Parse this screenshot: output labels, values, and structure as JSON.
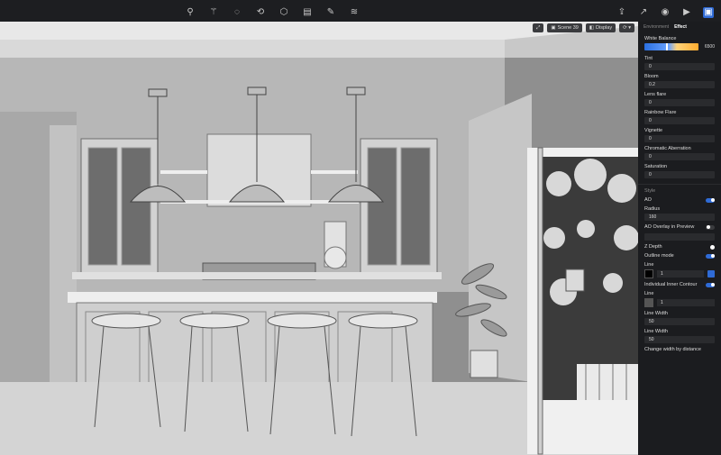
{
  "tools": [
    "pin-icon",
    "wand-icon",
    "lasso-icon",
    "refresh-icon",
    "cube-icon",
    "film-icon",
    "brush-icon",
    "layers-icon"
  ],
  "right_icons": [
    "import-icon",
    "share-icon",
    "camera-icon",
    "video-icon",
    "panel-icon"
  ],
  "viewport": {
    "scene_label": "Scene 39",
    "display_label": "Display"
  },
  "panel": {
    "tabs": [
      {
        "label": "Environment"
      },
      {
        "label": "Effect"
      }
    ],
    "white_balance": {
      "label": "White Balance",
      "value": "6500"
    },
    "effects": [
      {
        "label": "Tint",
        "value": "0"
      },
      {
        "label": "Bloom",
        "value": "0.2"
      },
      {
        "label": "Lens flare",
        "value": "0"
      },
      {
        "label": "Rainbow Flare",
        "value": "0"
      },
      {
        "label": "Vignette",
        "value": "0"
      },
      {
        "label": "Chromatic Aberration",
        "value": "0"
      },
      {
        "label": "Saturation",
        "value": "0"
      }
    ],
    "style_title": "Style",
    "ao_label": "AO",
    "radius_label": "Radius",
    "radius_value": "160",
    "ao_overlay_label": "AO Overlay in Preview",
    "zdepth_label": "Z Depth",
    "outline_label": "Outline mode",
    "line_label": "Line",
    "line_value": "1",
    "inner_label": "Individual Inner Contour",
    "line2_label": "Line",
    "line2_value": "1",
    "lw_label": "Line Width",
    "lw_value": "50",
    "lw2_label": "Line Width",
    "lw2_value": "50",
    "change_label": "Change width by distance"
  }
}
